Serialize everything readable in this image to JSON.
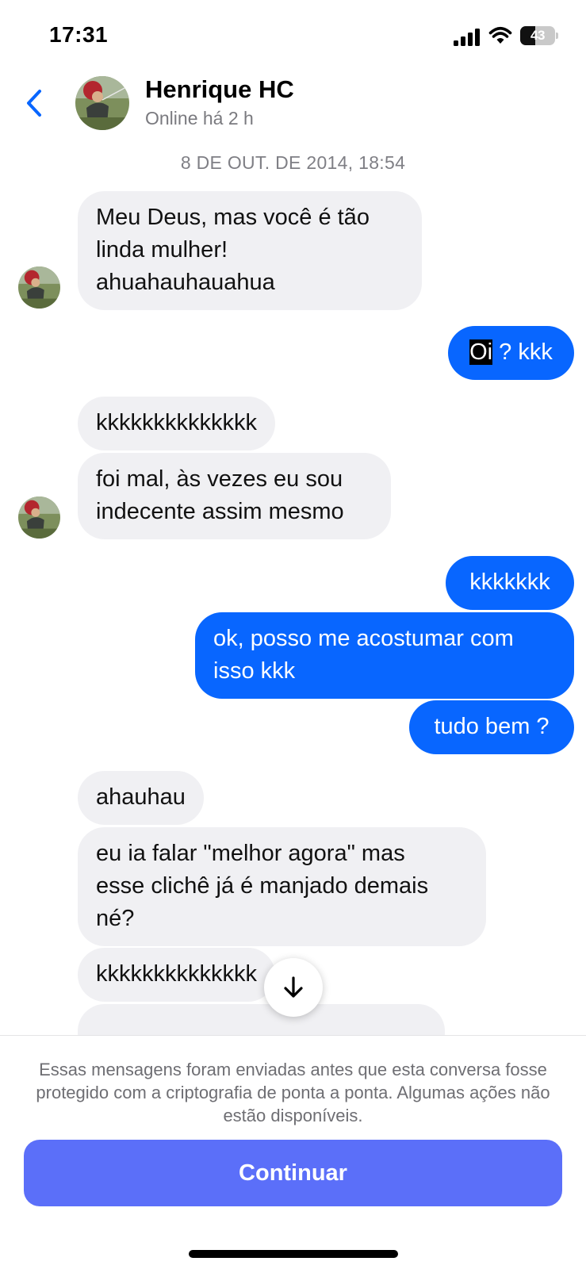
{
  "status_bar": {
    "time": "17:31",
    "battery_level": "43",
    "icons": [
      "signal-icon",
      "wifi-icon",
      "battery-icon"
    ]
  },
  "header": {
    "back_icon": "chevron-left-icon",
    "contact_name": "Henrique HC",
    "contact_status": "Online há 2 h"
  },
  "chat": {
    "date_separator": "8 DE OUT. DE 2014, 18:54",
    "messages": [
      {
        "from": "them",
        "lines": [
          "Meu Deus, mas você é tão",
          "linda mulher!",
          "ahuahauhauahua"
        ]
      },
      {
        "from": "me",
        "highlighted": "Oi",
        "text": " ? kkk"
      },
      {
        "from": "them",
        "text": "kkkkkkkkkkkkkk"
      },
      {
        "from": "them",
        "lines": [
          "foi mal, às vezes eu sou",
          "indecente assim mesmo"
        ]
      },
      {
        "from": "me",
        "text": "kkkkkkk"
      },
      {
        "from": "me",
        "lines": [
          "ok, posso me acostumar com",
          "isso kkk"
        ]
      },
      {
        "from": "me",
        "text": "tudo bem ?"
      },
      {
        "from": "them",
        "text": "ahauhau"
      },
      {
        "from": "them",
        "lines": [
          "eu ia falar \"melhor agora\" mas",
          "esse clichê já é manjado demais",
          "né?"
        ]
      },
      {
        "from": "them",
        "text": "kkkkkkkkkkkkkk"
      }
    ],
    "scroll_down_icon": "arrow-down-icon"
  },
  "footer": {
    "notice": "Essas mensagens foram enviadas antes que esta conversa fosse protegido com a criptografia de ponta a ponta. Algumas ações não estão disponíveis.",
    "continue_label": "Continuar"
  },
  "colors": {
    "outgoing_bubble": "#0866ff",
    "incoming_bubble": "#f0f0f3",
    "back_chevron": "#0866ff",
    "continue_button": "#5b6ff9",
    "secondary_text": "#7a7a7f"
  }
}
